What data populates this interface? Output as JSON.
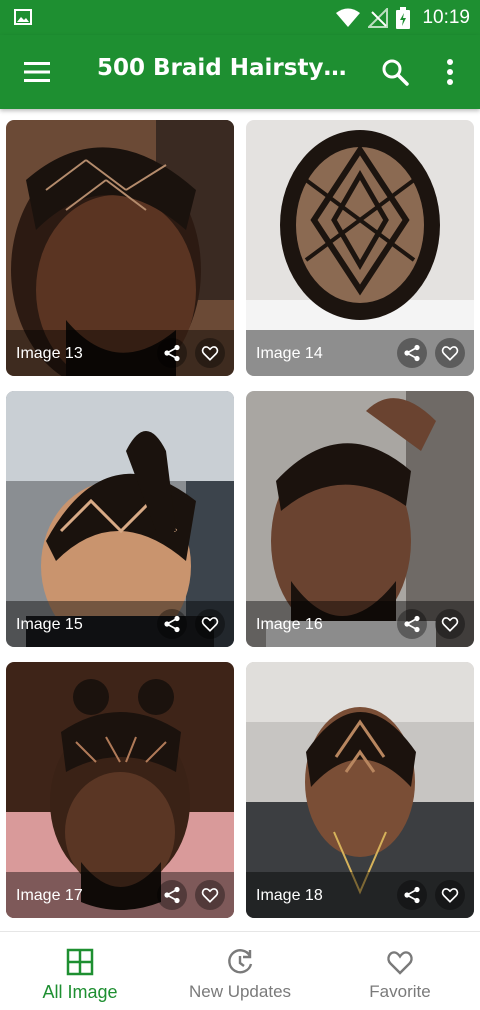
{
  "status_bar": {
    "time": "10:19"
  },
  "app_bar": {
    "title": "500 Braid Hairstyle...",
    "icons": [
      "menu-icon",
      "search-icon",
      "more-vert-icon"
    ]
  },
  "colors": {
    "primary": "#1e8f31",
    "inactive": "#7a7a7a"
  },
  "images": [
    {
      "label": "Image 13"
    },
    {
      "label": "Image 14"
    },
    {
      "label": "Image 15"
    },
    {
      "label": "Image 16"
    },
    {
      "label": "Image 17"
    },
    {
      "label": "Image 18"
    }
  ],
  "bottom_nav": {
    "items": [
      {
        "label": "All Image",
        "icon": "grid-icon",
        "active": true
      },
      {
        "label": "New Updates",
        "icon": "update-clock-icon",
        "active": false
      },
      {
        "label": "Favorite",
        "icon": "heart-outline-icon",
        "active": false
      }
    ]
  }
}
